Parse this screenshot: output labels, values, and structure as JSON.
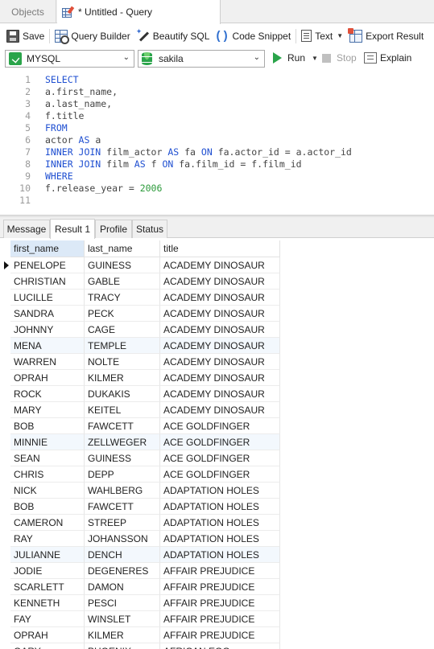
{
  "tabs": {
    "objects": "Objects",
    "query": "* Untitled - Query"
  },
  "toolbar": {
    "save": "Save",
    "query_builder": "Query Builder",
    "beautify": "Beautify SQL",
    "snippet": "Code Snippet",
    "text": "Text",
    "export": "Export Result"
  },
  "connection": {
    "name": "MYSQL",
    "database": "sakila",
    "run": "Run",
    "stop": "Stop",
    "explain": "Explain"
  },
  "editor": {
    "line_numbers": [
      "1",
      "2",
      "3",
      "4",
      "5",
      "6",
      "7",
      "8",
      "9",
      "10",
      "11"
    ],
    "lines": [
      "SELECT",
      "a.first_name,",
      "a.last_name,",
      "f.title",
      "FROM",
      "actor AS a",
      "INNER JOIN film_actor AS fa ON fa.actor_id = a.actor_id",
      "INNER JOIN film AS f ON fa.film_id = f.film_id",
      "WHERE",
      "f.release_year = 2006",
      ""
    ]
  },
  "result_tabs": [
    "Message",
    "Result 1",
    "Profile",
    "Status"
  ],
  "active_result_tab": "Result 1",
  "grid": {
    "columns": [
      "first_name",
      "last_name",
      "title"
    ],
    "rows": [
      [
        "PENELOPE",
        "GUINESS",
        "ACADEMY DINOSAUR"
      ],
      [
        "CHRISTIAN",
        "GABLE",
        "ACADEMY DINOSAUR"
      ],
      [
        "LUCILLE",
        "TRACY",
        "ACADEMY DINOSAUR"
      ],
      [
        "SANDRA",
        "PECK",
        "ACADEMY DINOSAUR"
      ],
      [
        "JOHNNY",
        "CAGE",
        "ACADEMY DINOSAUR"
      ],
      [
        "MENA",
        "TEMPLE",
        "ACADEMY DINOSAUR"
      ],
      [
        "WARREN",
        "NOLTE",
        "ACADEMY DINOSAUR"
      ],
      [
        "OPRAH",
        "KILMER",
        "ACADEMY DINOSAUR"
      ],
      [
        "ROCK",
        "DUKAKIS",
        "ACADEMY DINOSAUR"
      ],
      [
        "MARY",
        "KEITEL",
        "ACADEMY DINOSAUR"
      ],
      [
        "BOB",
        "FAWCETT",
        "ACE GOLDFINGER"
      ],
      [
        "MINNIE",
        "ZELLWEGER",
        "ACE GOLDFINGER"
      ],
      [
        "SEAN",
        "GUINESS",
        "ACE GOLDFINGER"
      ],
      [
        "CHRIS",
        "DEPP",
        "ACE GOLDFINGER"
      ],
      [
        "NICK",
        "WAHLBERG",
        "ADAPTATION HOLES"
      ],
      [
        "BOB",
        "FAWCETT",
        "ADAPTATION HOLES"
      ],
      [
        "CAMERON",
        "STREEP",
        "ADAPTATION HOLES"
      ],
      [
        "RAY",
        "JOHANSSON",
        "ADAPTATION HOLES"
      ],
      [
        "JULIANNE",
        "DENCH",
        "ADAPTATION HOLES"
      ],
      [
        "JODIE",
        "DEGENERES",
        "AFFAIR PREJUDICE"
      ],
      [
        "SCARLETT",
        "DAMON",
        "AFFAIR PREJUDICE"
      ],
      [
        "KENNETH",
        "PESCI",
        "AFFAIR PREJUDICE"
      ],
      [
        "FAY",
        "WINSLET",
        "AFFAIR PREJUDICE"
      ],
      [
        "OPRAH",
        "KILMER",
        "AFFAIR PREJUDICE"
      ],
      [
        "GARY",
        "PHOENIX",
        "AFRICAN EGG"
      ]
    ]
  },
  "colors": {
    "keyword": "#1f4fd1",
    "number": "#2b9a3a",
    "run_green": "#2aa44a",
    "header_highlight": "#dce9f7"
  }
}
